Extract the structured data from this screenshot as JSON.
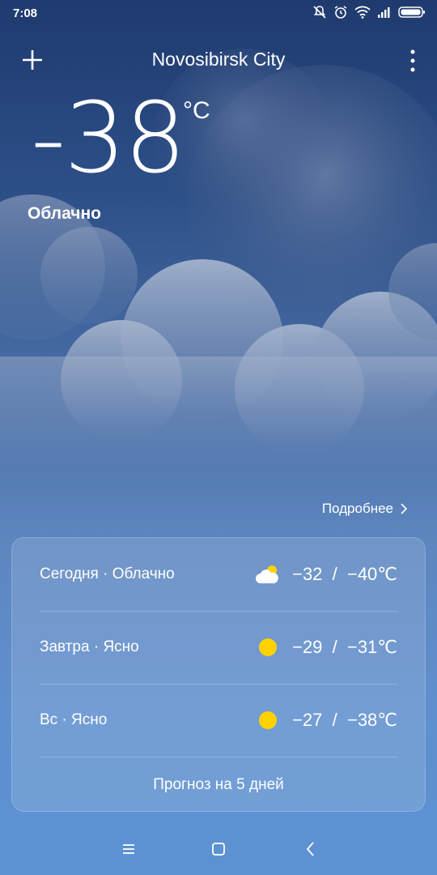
{
  "status": {
    "time": "7:08"
  },
  "header": {
    "city": "Novosibirsk City"
  },
  "current": {
    "temperature": "-38",
    "unit": "°C",
    "condition": "Облачно"
  },
  "details_link": "Подробнее",
  "forecast": {
    "rows": [
      {
        "label": "Сегодня · Облачно",
        "icon": "partly-cloudy-icon",
        "range": "−32  /  −40℃"
      },
      {
        "label": "Завтра · Ясно",
        "icon": "sun-icon",
        "range": "−29  /  −31℃"
      },
      {
        "label": "Вс · Ясно",
        "icon": "sun-icon",
        "range": "−27  /  −38℃"
      }
    ],
    "five_day_label": "Прогноз на 5 дней"
  },
  "colors": {
    "sun": "#ffd200"
  }
}
